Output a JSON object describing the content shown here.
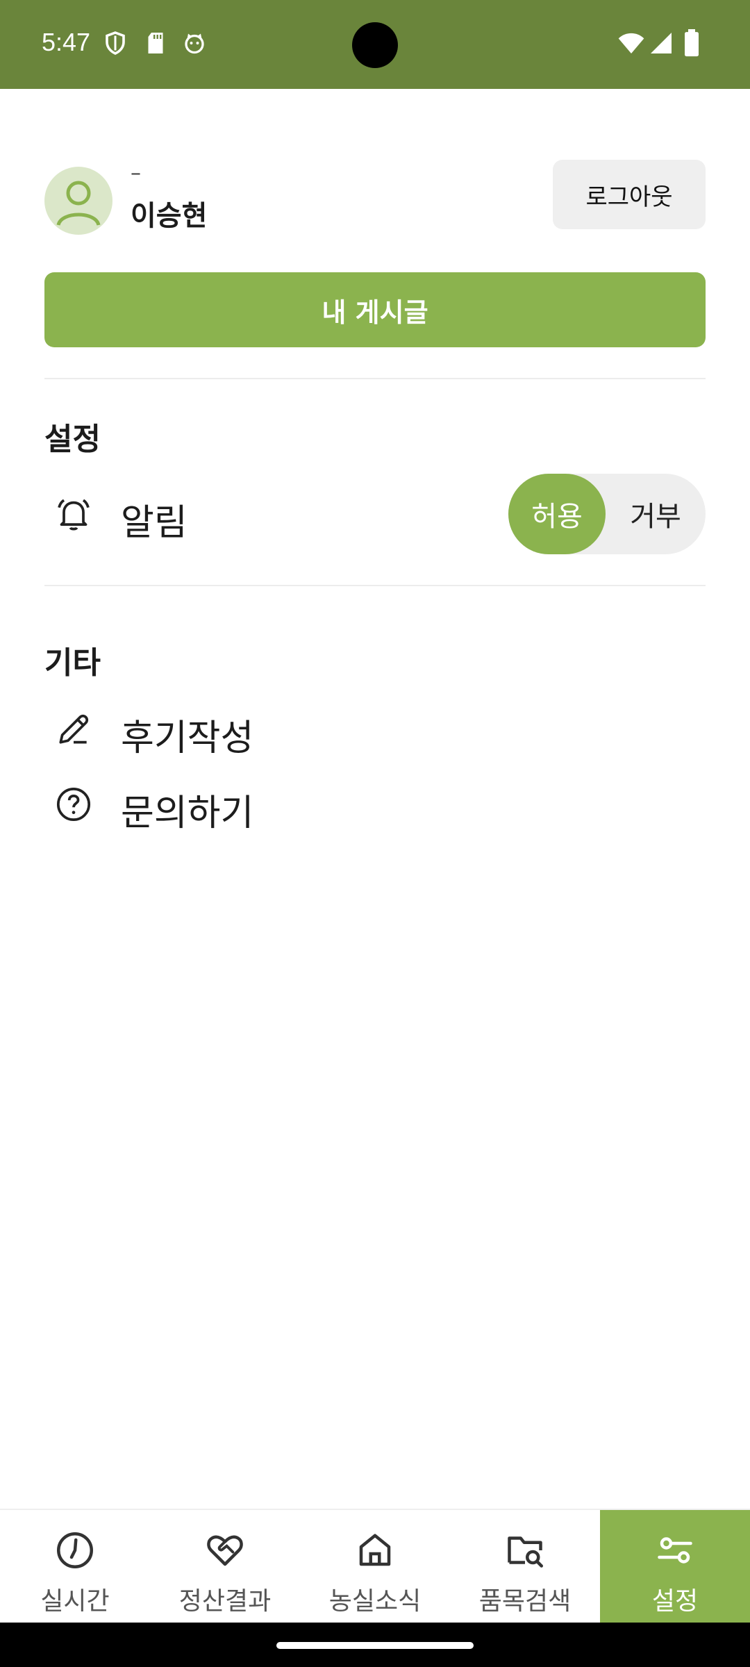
{
  "status_bar": {
    "time": "5:47",
    "left_icons": [
      "shield-icon",
      "sd-card-icon",
      "cat-face-icon"
    ],
    "right_icons": [
      "wifi-icon",
      "signal-icon",
      "battery-icon"
    ]
  },
  "profile": {
    "subtitle": "–",
    "name": "이승현",
    "logout_label": "로그아웃"
  },
  "my_posts_label": "내 게시글",
  "settings": {
    "title": "설정",
    "notification_label": "알림",
    "toggle": {
      "on_label": "허용",
      "off_label": "거부",
      "selected": "허용"
    }
  },
  "etc": {
    "title": "기타",
    "items": [
      {
        "label": "후기작성",
        "icon": "pencil-icon"
      },
      {
        "label": "문의하기",
        "icon": "question-icon"
      }
    ]
  },
  "bottom_nav": {
    "items": [
      {
        "label": "실시간",
        "icon": "clock-icon"
      },
      {
        "label": "정산결과",
        "icon": "handshake-heart-icon"
      },
      {
        "label": "농실소식",
        "icon": "home-icon"
      },
      {
        "label": "품목검색",
        "icon": "folder-search-icon"
      },
      {
        "label": "설정",
        "icon": "settings-sliders-icon"
      }
    ],
    "active": "설정"
  },
  "colors": {
    "status_bar": "#6a853b",
    "accent": "#8bb34e",
    "avatar_bg": "#dbe7c9"
  }
}
